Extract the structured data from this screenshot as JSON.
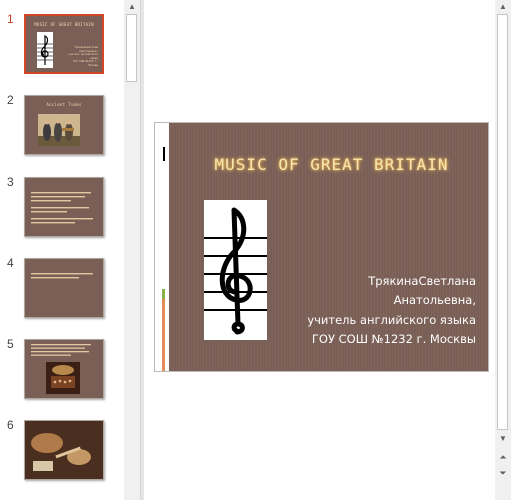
{
  "thumbnails": [
    {
      "number": "1",
      "title": "MUSIC OF GREAT BRITAIN",
      "text": [
        "ТрякинаСветлана",
        "Анатольевна,",
        "учитель английского языка",
        "ГОУ СОШ №1232 г. Москвы"
      ]
    },
    {
      "number": "2",
      "title": "Ancient Times",
      "text": []
    },
    {
      "number": "3",
      "title": "",
      "text": []
    },
    {
      "number": "4",
      "title": "",
      "text": []
    },
    {
      "number": "5",
      "title": "",
      "text": []
    },
    {
      "number": "6",
      "title": "",
      "text": []
    }
  ],
  "slide": {
    "title": "MUSIC OF GREAT BRITAIN",
    "author_lines": [
      "ТрякинаСветлана",
      "Анатольевна,",
      "учитель английского языка",
      "ГОУ СОШ №1232 г. Москвы"
    ]
  },
  "colors": {
    "slide_bg": "#7a5f56",
    "title_glow": "#f2c25c",
    "selection": "#d24726"
  },
  "icons": {
    "scroll_up": "up-arrow-icon",
    "scroll_down": "down-arrow-icon",
    "prev_slide": "double-up-arrow-icon",
    "next_slide": "double-down-arrow-icon"
  }
}
